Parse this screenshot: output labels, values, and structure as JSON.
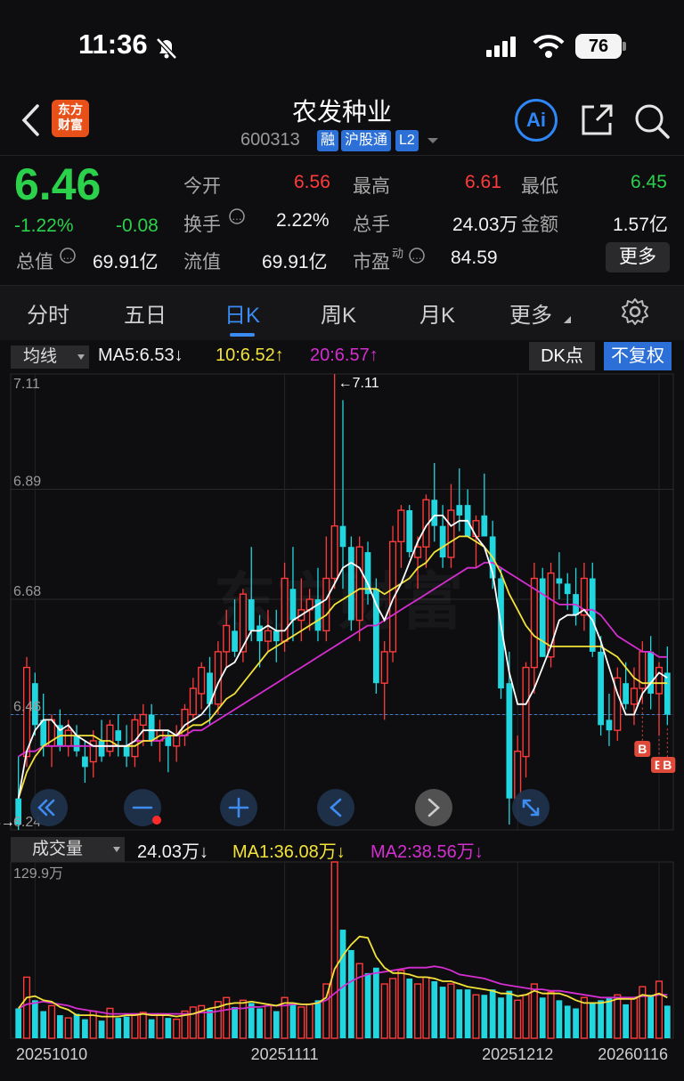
{
  "status_bar": {
    "time": "11:36",
    "battery": "76"
  },
  "header": {
    "name": "农发种业",
    "code": "600313",
    "tags": [
      "融",
      "沪股通",
      "L2"
    ],
    "logo": [
      "东方",
      "财富"
    ],
    "ai_label": "Ai"
  },
  "quote": {
    "price": "6.46",
    "change_pct": "-1.22%",
    "change": "-0.08",
    "open_label": "今开",
    "open": "6.56",
    "high_label": "最高",
    "high": "6.61",
    "low_label": "最低",
    "low": "6.45",
    "turnover_label": "换手",
    "turnover": "2.22%",
    "volume_label": "总手",
    "volume": "24.03万",
    "amount_label": "金额",
    "amount": "1.57亿",
    "mktcap_label": "总值",
    "mktcap": "69.91亿",
    "float_label": "流值",
    "float_cap": "69.91亿",
    "pe_label": "市盈",
    "pe_sup": "动",
    "pe": "84.59",
    "more": "更多"
  },
  "tabs": [
    "分时",
    "五日",
    "日K",
    "周K",
    "月K",
    "更多"
  ],
  "active_tab": 2,
  "ma_bar": {
    "select": "均线",
    "ma5": "MA5:6.53↓",
    "ma10": "10:6.52↑",
    "ma20": "20:6.57↑",
    "dk": "DK点",
    "fq": "不复权"
  },
  "colors": {
    "up": "#ff3b3b",
    "down": "#22d6e0",
    "ma5": "#ffffff",
    "ma10": "#f2e23a",
    "ma20": "#d52ed0",
    "price_green": "#2bd14a"
  },
  "price_axis": [
    "7.11",
    "6.89",
    "6.68",
    "6.46",
    "6.24"
  ],
  "price_marks": {
    "max_label": "←7.11",
    "min_label": "6.24→"
  },
  "signal_marker": "B",
  "vol_bar": {
    "select": "成交量",
    "vol": "24.03万↓",
    "ma1": "MA1:36.08万↓",
    "ma2": "MA2:38.56万↓",
    "axis_max": "129.9万"
  },
  "dates": [
    "20251010",
    "20251111",
    "20251212",
    "20260116"
  ],
  "chart_data": {
    "type": "candlestick",
    "ylim": [
      6.24,
      7.11
    ],
    "vol_max": 129.9,
    "candles": [
      [
        6.3,
        6.38,
        6.24,
        6.25,
        22
      ],
      [
        6.38,
        6.57,
        6.36,
        6.55,
        45
      ],
      [
        6.52,
        6.54,
        6.42,
        6.44,
        28
      ],
      [
        6.45,
        6.5,
        6.38,
        6.4,
        20
      ],
      [
        6.4,
        6.46,
        6.36,
        6.45,
        24
      ],
      [
        6.44,
        6.47,
        6.39,
        6.4,
        17
      ],
      [
        6.4,
        6.45,
        6.38,
        6.43,
        15
      ],
      [
        6.42,
        6.44,
        6.38,
        6.39,
        18
      ],
      [
        6.38,
        6.41,
        6.33,
        6.36,
        14
      ],
      [
        6.37,
        6.43,
        6.34,
        6.41,
        20
      ],
      [
        6.41,
        6.45,
        6.37,
        6.38,
        13
      ],
      [
        6.39,
        6.45,
        6.38,
        6.44,
        22
      ],
      [
        6.43,
        6.46,
        6.38,
        6.41,
        15
      ],
      [
        6.4,
        6.44,
        6.36,
        6.38,
        16
      ],
      [
        6.38,
        6.46,
        6.36,
        6.45,
        18
      ],
      [
        6.44,
        6.48,
        6.4,
        6.46,
        19
      ],
      [
        6.46,
        6.48,
        6.4,
        6.41,
        14
      ],
      [
        6.41,
        6.45,
        6.37,
        6.43,
        18
      ],
      [
        6.42,
        6.43,
        6.35,
        6.4,
        15
      ],
      [
        6.4,
        6.44,
        6.37,
        6.42,
        14
      ],
      [
        6.42,
        6.48,
        6.4,
        6.47,
        20
      ],
      [
        6.46,
        6.53,
        6.45,
        6.51,
        23
      ],
      [
        6.5,
        6.56,
        6.47,
        6.55,
        24
      ],
      [
        6.54,
        6.57,
        6.44,
        6.48,
        21
      ],
      [
        6.48,
        6.6,
        6.46,
        6.58,
        27
      ],
      [
        6.58,
        6.66,
        6.55,
        6.63,
        30
      ],
      [
        6.62,
        6.68,
        6.57,
        6.58,
        23
      ],
      [
        6.58,
        6.7,
        6.56,
        6.69,
        28
      ],
      [
        6.68,
        6.78,
        6.6,
        6.62,
        26
      ],
      [
        6.63,
        6.65,
        6.55,
        6.6,
        22
      ],
      [
        6.6,
        6.66,
        6.58,
        6.62,
        24
      ],
      [
        6.62,
        6.66,
        6.56,
        6.6,
        20
      ],
      [
        6.6,
        6.75,
        6.58,
        6.72,
        30
      ],
      [
        6.7,
        6.78,
        6.6,
        6.64,
        26
      ],
      [
        6.64,
        6.72,
        6.6,
        6.66,
        23
      ],
      [
        6.66,
        6.7,
        6.62,
        6.68,
        25
      ],
      [
        6.68,
        6.74,
        6.6,
        6.62,
        28
      ],
      [
        6.62,
        6.8,
        6.6,
        6.72,
        40
      ],
      [
        6.72,
        7.11,
        6.7,
        6.82,
        129.9
      ],
      [
        6.82,
        7.06,
        6.7,
        6.78,
        80
      ],
      [
        6.78,
        6.8,
        6.62,
        6.64,
        65
      ],
      [
        6.64,
        6.8,
        6.6,
        6.78,
        55
      ],
      [
        6.77,
        6.79,
        6.67,
        6.69,
        48
      ],
      [
        6.7,
        6.72,
        6.5,
        6.52,
        52
      ],
      [
        6.52,
        6.6,
        6.45,
        6.58,
        40
      ],
      [
        6.58,
        6.82,
        6.56,
        6.79,
        44
      ],
      [
        6.79,
        6.86,
        6.74,
        6.85,
        50
      ],
      [
        6.85,
        6.86,
        6.76,
        6.77,
        44
      ],
      [
        6.76,
        6.8,
        6.7,
        6.78,
        40
      ],
      [
        6.78,
        6.88,
        6.74,
        6.87,
        45
      ],
      [
        6.87,
        6.94,
        6.79,
        6.82,
        42
      ],
      [
        6.82,
        6.86,
        6.74,
        6.76,
        38
      ],
      [
        6.76,
        6.9,
        6.74,
        6.85,
        40
      ],
      [
        6.86,
        6.93,
        6.81,
        6.84,
        36
      ],
      [
        6.86,
        6.89,
        6.8,
        6.8,
        36
      ],
      [
        6.8,
        6.84,
        6.74,
        6.83,
        32
      ],
      [
        6.84,
        6.92,
        6.8,
        6.8,
        32
      ],
      [
        6.8,
        6.83,
        6.7,
        6.72,
        36
      ],
      [
        6.72,
        6.74,
        6.49,
        6.51,
        30
      ],
      [
        6.52,
        6.58,
        6.25,
        6.3,
        35
      ],
      [
        6.3,
        6.42,
        6.26,
        6.39,
        28
      ],
      [
        6.38,
        6.56,
        6.34,
        6.55,
        32
      ],
      [
        6.55,
        6.75,
        6.5,
        6.72,
        40
      ],
      [
        6.72,
        6.74,
        6.57,
        6.57,
        30
      ],
      [
        6.57,
        6.75,
        6.55,
        6.73,
        34
      ],
      [
        6.72,
        6.77,
        6.68,
        6.71,
        28
      ],
      [
        6.71,
        6.73,
        6.66,
        6.69,
        24
      ],
      [
        6.69,
        6.74,
        6.63,
        6.65,
        22
      ],
      [
        6.65,
        6.75,
        6.62,
        6.72,
        30
      ],
      [
        6.72,
        6.75,
        6.57,
        6.58,
        26
      ],
      [
        6.58,
        6.61,
        6.42,
        6.44,
        28
      ],
      [
        6.45,
        6.5,
        6.4,
        6.43,
        30
      ],
      [
        6.43,
        6.55,
        6.41,
        6.53,
        32
      ],
      [
        6.52,
        6.56,
        6.47,
        6.48,
        25
      ],
      [
        6.48,
        6.55,
        6.44,
        6.51,
        30
      ],
      [
        6.51,
        6.6,
        6.48,
        6.58,
        38
      ],
      [
        6.58,
        6.61,
        6.47,
        6.5,
        32
      ],
      [
        6.5,
        6.56,
        6.42,
        6.55,
        42
      ],
      [
        6.54,
        6.59,
        6.44,
        6.46,
        24.03
      ]
    ],
    "ma5": [
      6.3,
      6.39,
      6.43,
      6.45,
      6.45,
      6.43,
      6.44,
      6.42,
      6.41,
      6.4,
      6.4,
      6.4,
      6.4,
      6.4,
      6.41,
      6.43,
      6.43,
      6.43,
      6.43,
      6.42,
      6.44,
      6.45,
      6.46,
      6.48,
      6.52,
      6.55,
      6.56,
      6.59,
      6.62,
      6.62,
      6.63,
      6.62,
      6.62,
      6.64,
      6.65,
      6.66,
      6.67,
      6.68,
      6.71,
      6.74,
      6.75,
      6.74,
      6.71,
      6.67,
      6.64,
      6.68,
      6.71,
      6.75,
      6.79,
      6.82,
      6.84,
      6.84,
      6.82,
      6.83,
      6.83,
      6.8,
      6.78,
      6.73,
      6.63,
      6.54,
      6.48,
      6.48,
      6.51,
      6.55,
      6.59,
      6.64,
      6.65,
      6.65,
      6.66,
      6.64,
      6.6,
      6.55,
      6.5,
      6.46,
      6.46,
      6.5,
      6.52,
      6.54,
      6.53
    ],
    "ma10": [
      6.3,
      6.35,
      6.38,
      6.4,
      6.41,
      6.42,
      6.42,
      6.42,
      6.42,
      6.42,
      6.41,
      6.41,
      6.4,
      6.4,
      6.4,
      6.41,
      6.41,
      6.42,
      6.42,
      6.42,
      6.43,
      6.44,
      6.44,
      6.45,
      6.47,
      6.49,
      6.5,
      6.52,
      6.54,
      6.56,
      6.58,
      6.59,
      6.6,
      6.61,
      6.62,
      6.63,
      6.64,
      6.65,
      6.67,
      6.68,
      6.69,
      6.7,
      6.7,
      6.7,
      6.69,
      6.7,
      6.71,
      6.72,
      6.74,
      6.75,
      6.77,
      6.78,
      6.79,
      6.8,
      6.8,
      6.79,
      6.78,
      6.76,
      6.73,
      6.69,
      6.66,
      6.63,
      6.61,
      6.6,
      6.59,
      6.59,
      6.59,
      6.59,
      6.59,
      6.59,
      6.59,
      6.58,
      6.57,
      6.55,
      6.53,
      6.52,
      6.52,
      6.52,
      6.52
    ],
    "ma20": [
      6.38,
      6.39,
      6.39,
      6.4,
      6.4,
      6.4,
      6.4,
      6.4,
      6.4,
      6.4,
      6.4,
      6.4,
      6.4,
      6.4,
      6.41,
      6.41,
      6.41,
      6.41,
      6.42,
      6.42,
      6.42,
      6.43,
      6.43,
      6.44,
      6.45,
      6.46,
      6.47,
      6.48,
      6.49,
      6.5,
      6.51,
      6.52,
      6.53,
      6.54,
      6.55,
      6.56,
      6.57,
      6.58,
      6.59,
      6.6,
      6.61,
      6.62,
      6.63,
      6.63,
      6.64,
      6.65,
      6.66,
      6.67,
      6.68,
      6.69,
      6.7,
      6.71,
      6.72,
      6.73,
      6.74,
      6.74,
      6.75,
      6.75,
      6.74,
      6.73,
      6.72,
      6.71,
      6.7,
      6.69,
      6.68,
      6.67,
      6.67,
      6.67,
      6.66,
      6.66,
      6.65,
      6.63,
      6.61,
      6.6,
      6.59,
      6.58,
      6.58,
      6.57,
      6.57
    ],
    "vol_ma1": [
      22,
      30,
      31,
      28,
      27,
      23,
      21,
      17,
      17,
      17,
      16,
      16,
      16,
      17,
      17,
      18,
      17,
      17,
      17,
      16,
      17,
      18,
      20,
      22,
      23,
      25,
      26,
      26,
      27,
      26,
      25,
      24,
      26,
      26,
      25,
      25,
      26,
      30,
      51,
      61,
      69,
      75,
      74,
      60,
      52,
      48,
      48,
      47,
      45,
      45,
      44,
      42,
      42,
      40,
      38,
      37,
      36,
      35,
      33,
      33,
      31,
      32,
      35,
      33,
      33,
      33,
      31,
      28,
      26,
      26,
      26,
      27,
      29,
      29,
      29,
      32,
      31,
      33,
      30
    ],
    "vol_ma2": [
      22,
      25,
      26,
      27,
      26,
      25,
      24,
      22,
      21,
      20,
      19,
      18,
      18,
      18,
      18,
      18,
      18,
      18,
      18,
      18,
      18,
      18,
      19,
      19,
      20,
      21,
      22,
      22,
      23,
      23,
      24,
      24,
      24,
      25,
      25,
      25,
      26,
      28,
      33,
      38,
      42,
      45,
      47,
      48,
      49,
      50,
      51,
      52,
      52,
      52,
      53,
      52,
      50,
      47,
      46,
      45,
      44,
      42,
      40,
      39,
      38,
      37,
      36,
      36,
      35,
      35,
      34,
      33,
      32,
      31,
      30,
      30,
      30,
      30,
      30,
      31,
      31,
      32,
      32
    ]
  }
}
